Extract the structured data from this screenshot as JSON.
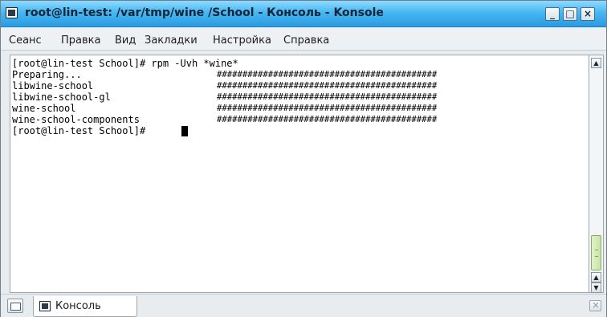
{
  "window": {
    "title": "root@lin-test: /var/tmp/wine /School - Консоль - Konsole",
    "minimize_glyph": "_",
    "maximize_glyph": "□",
    "close_glyph": "×"
  },
  "menubar": {
    "items": [
      "Сеанс",
      "Правка",
      "Вид",
      "Закладки",
      "Настройка",
      "Справка"
    ]
  },
  "terminal": {
    "lines": [
      {
        "text": "[root@lin-test School]# rpm -Uvh *wine*",
        "hashes": ""
      },
      {
        "text": "Preparing...",
        "hashes": "###########################################"
      },
      {
        "text": "libwine-school",
        "hashes": "###########################################"
      },
      {
        "text": "libwine-school-gl",
        "hashes": "###########################################"
      },
      {
        "text": "wine-school",
        "hashes": "###########################################"
      },
      {
        "text": "wine-school-components",
        "hashes": "###########################################"
      },
      {
        "text": "[root@lin-test School]# ",
        "hashes": ""
      }
    ]
  },
  "scrollbar": {
    "up_glyph": "▲",
    "down_glyph": "▼",
    "position": 1.0
  },
  "tabbar": {
    "tab_label": "Консоль"
  },
  "icons": {
    "window": "terminal-icon",
    "new_tab": "new-tab-icon",
    "tab": "terminal-icon",
    "close_tab": "close-tab-icon"
  },
  "colors": {
    "titlebar_accent": "#47b7f2",
    "scroll_thumb": "#c8e4a6"
  }
}
